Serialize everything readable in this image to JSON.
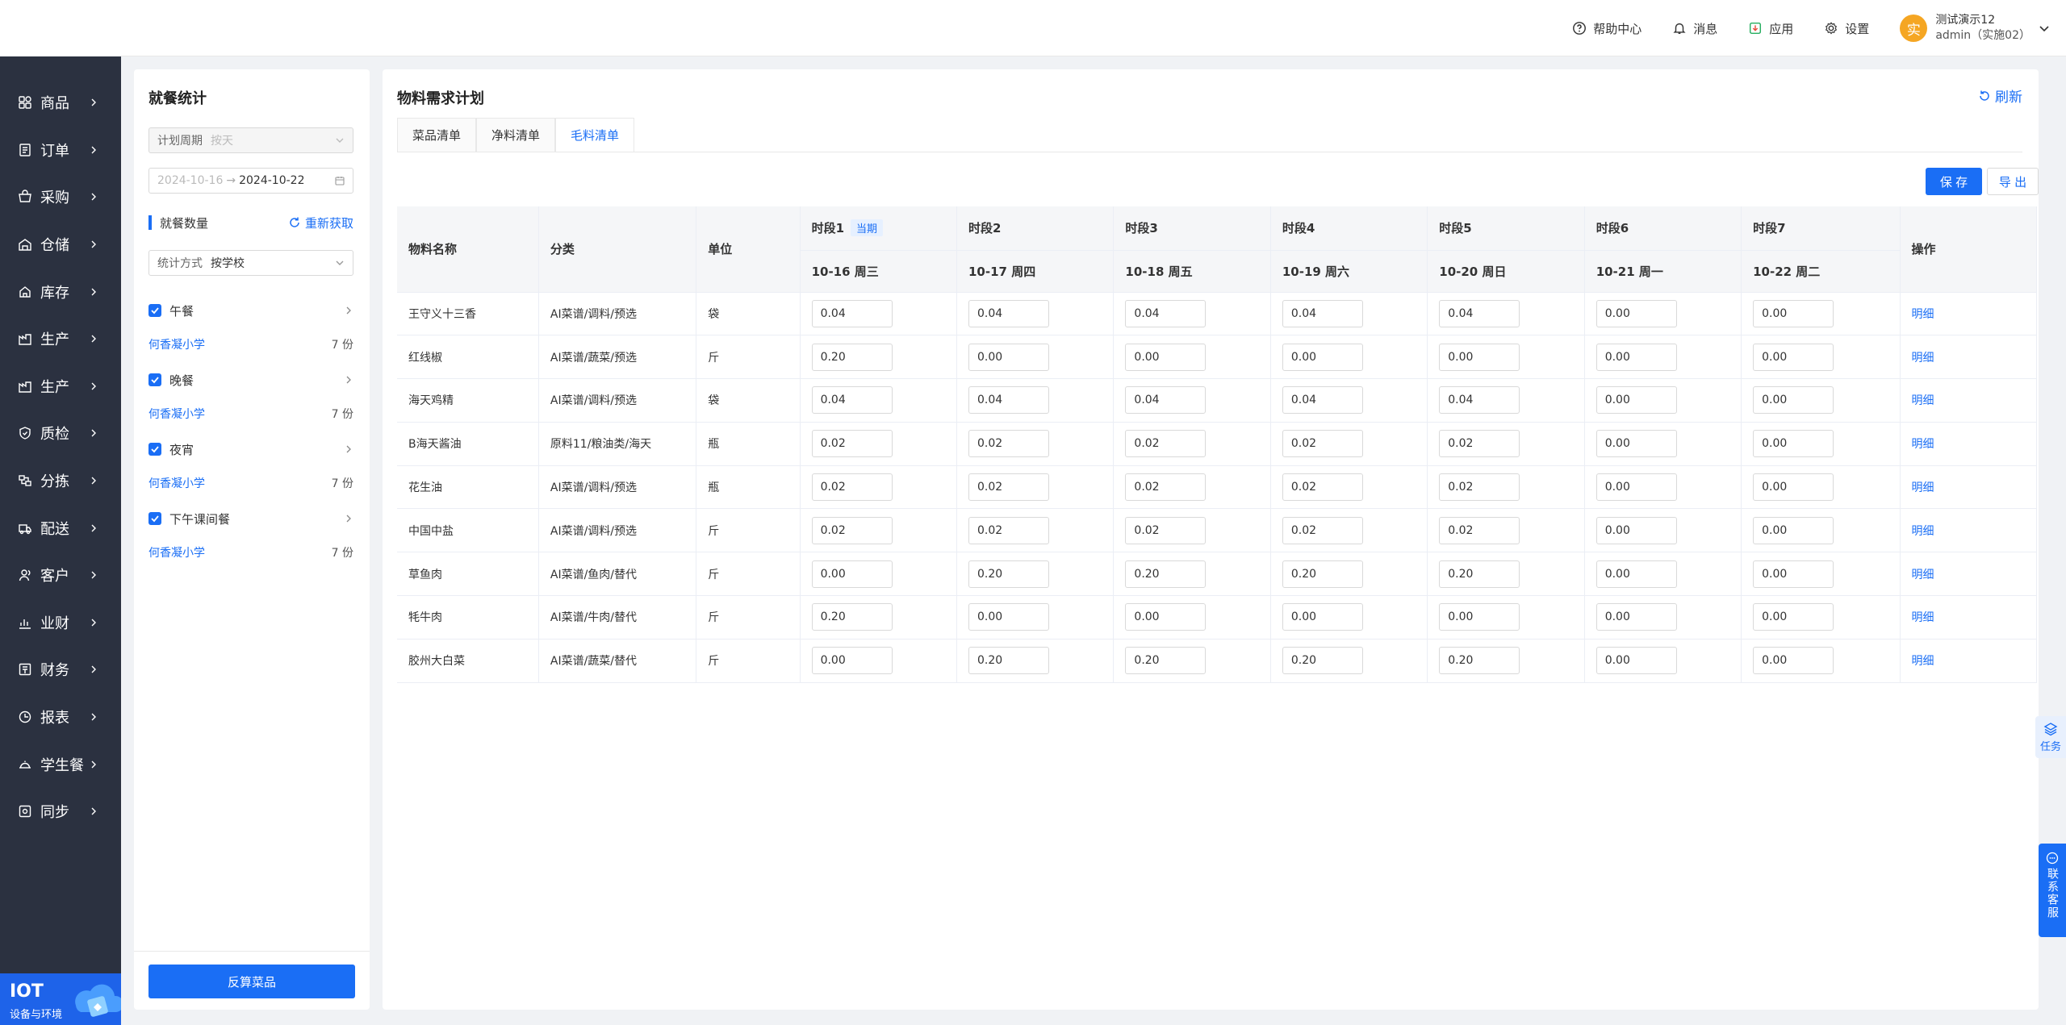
{
  "topbar": {
    "help": "帮助中心",
    "messages": "消息",
    "apps": "应用",
    "settings": "设置",
    "avatar_char": "实",
    "user_name": "测试演示12",
    "user_sub": "admin（实施02）"
  },
  "sidebar": {
    "items": [
      {
        "label": "商品",
        "icon": "grid-icon"
      },
      {
        "label": "订单",
        "icon": "order-icon"
      },
      {
        "label": "采购",
        "icon": "cart-icon"
      },
      {
        "label": "仓储",
        "icon": "warehouse-icon"
      },
      {
        "label": "库存",
        "icon": "inventory-icon"
      },
      {
        "label": "生产",
        "icon": "factory-icon"
      },
      {
        "label": "生产",
        "icon": "factory-icon"
      },
      {
        "label": "质检",
        "icon": "shield-icon"
      },
      {
        "label": "分拣",
        "icon": "sort-icon"
      },
      {
        "label": "配送",
        "icon": "truck-icon"
      },
      {
        "label": "客户",
        "icon": "user-icon"
      },
      {
        "label": "业财",
        "icon": "chart-icon"
      },
      {
        "label": "财务",
        "icon": "finance-icon"
      },
      {
        "label": "报表",
        "icon": "report-icon"
      },
      {
        "label": "学生餐",
        "icon": "dish-icon"
      },
      {
        "label": "同步",
        "icon": "sync-icon"
      }
    ],
    "footer_title": "IOT",
    "footer_sub": "设备与环境"
  },
  "left_panel": {
    "title": "就餐统计",
    "plan_cycle_label": "计划周期",
    "plan_cycle_value": "按天",
    "date_start": "2024-10-16",
    "date_sep": "→",
    "date_end": "2024-10-22",
    "section_label": "就餐数量",
    "refetch": "重新获取",
    "stat_method_label": "统计方式",
    "stat_method_value": "按学校",
    "meals": [
      {
        "name": "午餐",
        "school": "何香凝小学",
        "count": "7 份"
      },
      {
        "name": "晚餐",
        "school": "何香凝小学",
        "count": "7 份"
      },
      {
        "name": "夜宵",
        "school": "何香凝小学",
        "count": "7 份"
      },
      {
        "name": "下午课间餐",
        "school": "何香凝小学",
        "count": "7 份"
      }
    ],
    "recalc_button": "反算菜品"
  },
  "main": {
    "title": "物料需求计划",
    "refresh": "刷新",
    "tabs": [
      "菜品清单",
      "净料清单",
      "毛料清单"
    ],
    "active_tab": 2,
    "save": "保 存",
    "export": "导 出",
    "headers": {
      "name": "物料名称",
      "category": "分类",
      "unit": "单位",
      "action": "操作",
      "current_badge": "当期",
      "periods": [
        {
          "label": "时段1",
          "date": "10-16 周三"
        },
        {
          "label": "时段2",
          "date": "10-17 周四"
        },
        {
          "label": "时段3",
          "date": "10-18 周五"
        },
        {
          "label": "时段4",
          "date": "10-19 周六"
        },
        {
          "label": "时段5",
          "date": "10-20 周日"
        },
        {
          "label": "时段6",
          "date": "10-21 周一"
        },
        {
          "label": "时段7",
          "date": "10-22 周二"
        }
      ]
    },
    "rows": [
      {
        "name": "王守义十三香",
        "category": "AI菜谱/调料/预选",
        "unit": "袋",
        "values": [
          "0.04",
          "0.04",
          "0.04",
          "0.04",
          "0.04",
          "0.00",
          "0.00"
        ],
        "action": "明细"
      },
      {
        "name": "红线椒",
        "category": "AI菜谱/蔬菜/预选",
        "unit": "斤",
        "values": [
          "0.20",
          "0.00",
          "0.00",
          "0.00",
          "0.00",
          "0.00",
          "0.00"
        ],
        "action": "明细"
      },
      {
        "name": "海天鸡精",
        "category": "AI菜谱/调料/预选",
        "unit": "袋",
        "values": [
          "0.04",
          "0.04",
          "0.04",
          "0.04",
          "0.04",
          "0.00",
          "0.00"
        ],
        "action": "明细"
      },
      {
        "name": "B海天酱油",
        "category": "原料11/粮油类/海天",
        "unit": "瓶",
        "values": [
          "0.02",
          "0.02",
          "0.02",
          "0.02",
          "0.02",
          "0.00",
          "0.00"
        ],
        "action": "明细"
      },
      {
        "name": "花生油",
        "category": "AI菜谱/调料/预选",
        "unit": "瓶",
        "values": [
          "0.02",
          "0.02",
          "0.02",
          "0.02",
          "0.02",
          "0.00",
          "0.00"
        ],
        "action": "明细"
      },
      {
        "name": "中国中盐",
        "category": "AI菜谱/调料/预选",
        "unit": "斤",
        "values": [
          "0.02",
          "0.02",
          "0.02",
          "0.02",
          "0.02",
          "0.00",
          "0.00"
        ],
        "action": "明细"
      },
      {
        "name": "草鱼肉",
        "category": "AI菜谱/鱼肉/替代",
        "unit": "斤",
        "values": [
          "0.00",
          "0.20",
          "0.20",
          "0.20",
          "0.20",
          "0.00",
          "0.00"
        ],
        "action": "明细"
      },
      {
        "name": "牦牛肉",
        "category": "AI菜谱/牛肉/替代",
        "unit": "斤",
        "values": [
          "0.20",
          "0.00",
          "0.00",
          "0.00",
          "0.00",
          "0.00",
          "0.00"
        ],
        "action": "明细"
      },
      {
        "name": "胶州大白菜",
        "category": "AI菜谱/蔬菜/替代",
        "unit": "斤",
        "values": [
          "0.00",
          "0.20",
          "0.20",
          "0.20",
          "0.20",
          "0.00",
          "0.00"
        ],
        "action": "明细"
      }
    ]
  },
  "floating": {
    "task": "任务",
    "service": "联系客服"
  }
}
